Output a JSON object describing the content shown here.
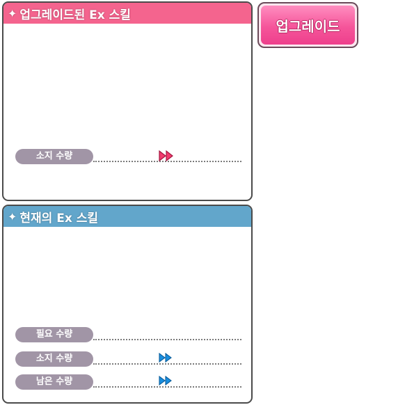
{
  "upgraded_panel": {
    "title": "업그레이드된 Ex 스킬",
    "header_color": "#f4648e",
    "rows": [
      {
        "label": "소지 수량",
        "icon": "fast-forward-icon",
        "icon_color": "#f23b6f"
      }
    ]
  },
  "current_panel": {
    "title": "현재의 Ex 스킬",
    "header_color": "#62a6cb",
    "rows": [
      {
        "label": "필요 수량",
        "icon": ""
      },
      {
        "label": "소지 수량",
        "icon": "fast-forward-icon",
        "icon_color": "#1a8fe0"
      },
      {
        "label": "남은 수량",
        "icon": "fast-forward-icon",
        "icon_color": "#1a8fe0"
      }
    ]
  },
  "upgrade_button": {
    "label": "업그레이드",
    "color": "#f5559a"
  },
  "sparkle_glyph": "✦"
}
